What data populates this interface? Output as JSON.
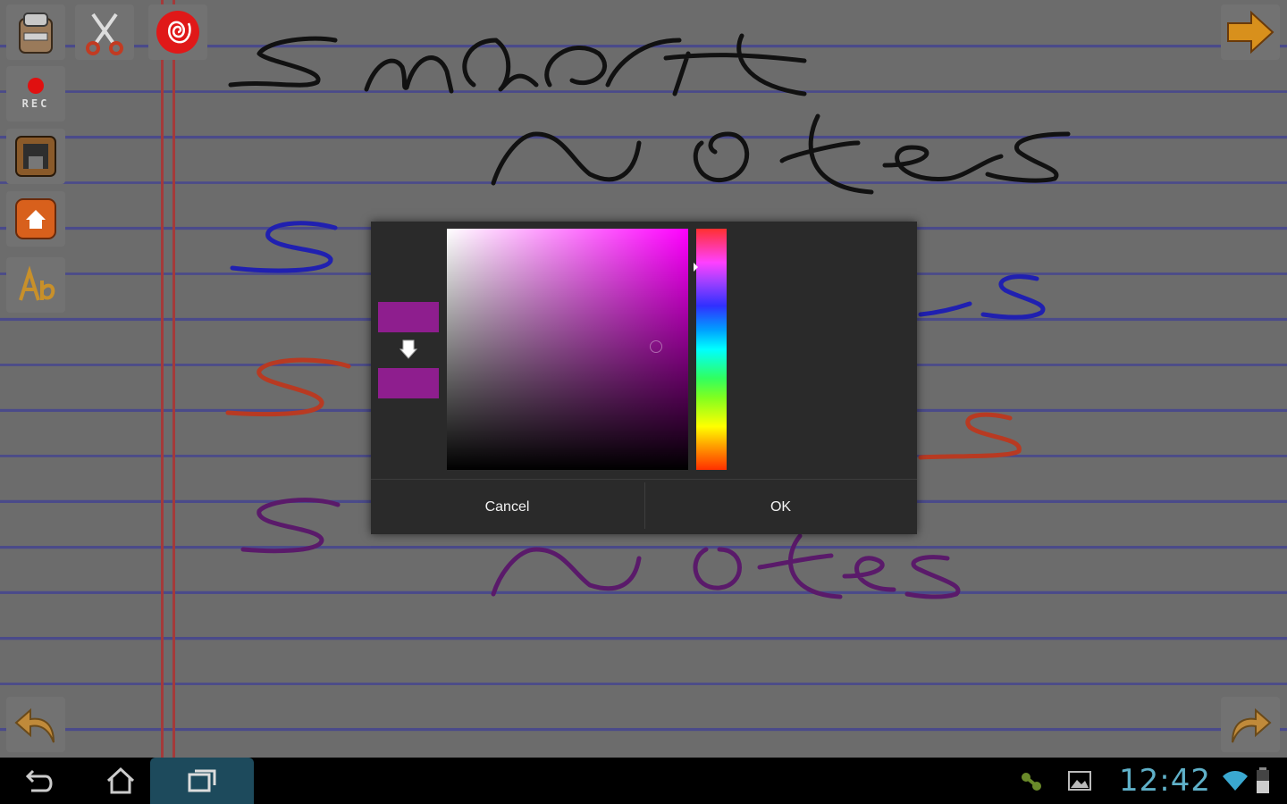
{
  "dialog": {
    "cancel_label": "Cancel",
    "ok_label": "OK",
    "old_color": "#8e1e8e",
    "new_color": "#8e1e8e",
    "hue_color": "#ff00ff"
  },
  "toolbar": {
    "items": [
      "notebook-icon",
      "scissors-icon",
      "spiral-icon",
      "record-icon",
      "save-icon",
      "home-icon",
      "text-icon"
    ],
    "rec_label": "REC"
  },
  "status_bar": {
    "time": "12:42"
  },
  "colors": {
    "paper": "#6c6c6c",
    "rule_line": "#4a4a8a",
    "margin_line": "#a43a3a",
    "accent": "#d8901c"
  }
}
